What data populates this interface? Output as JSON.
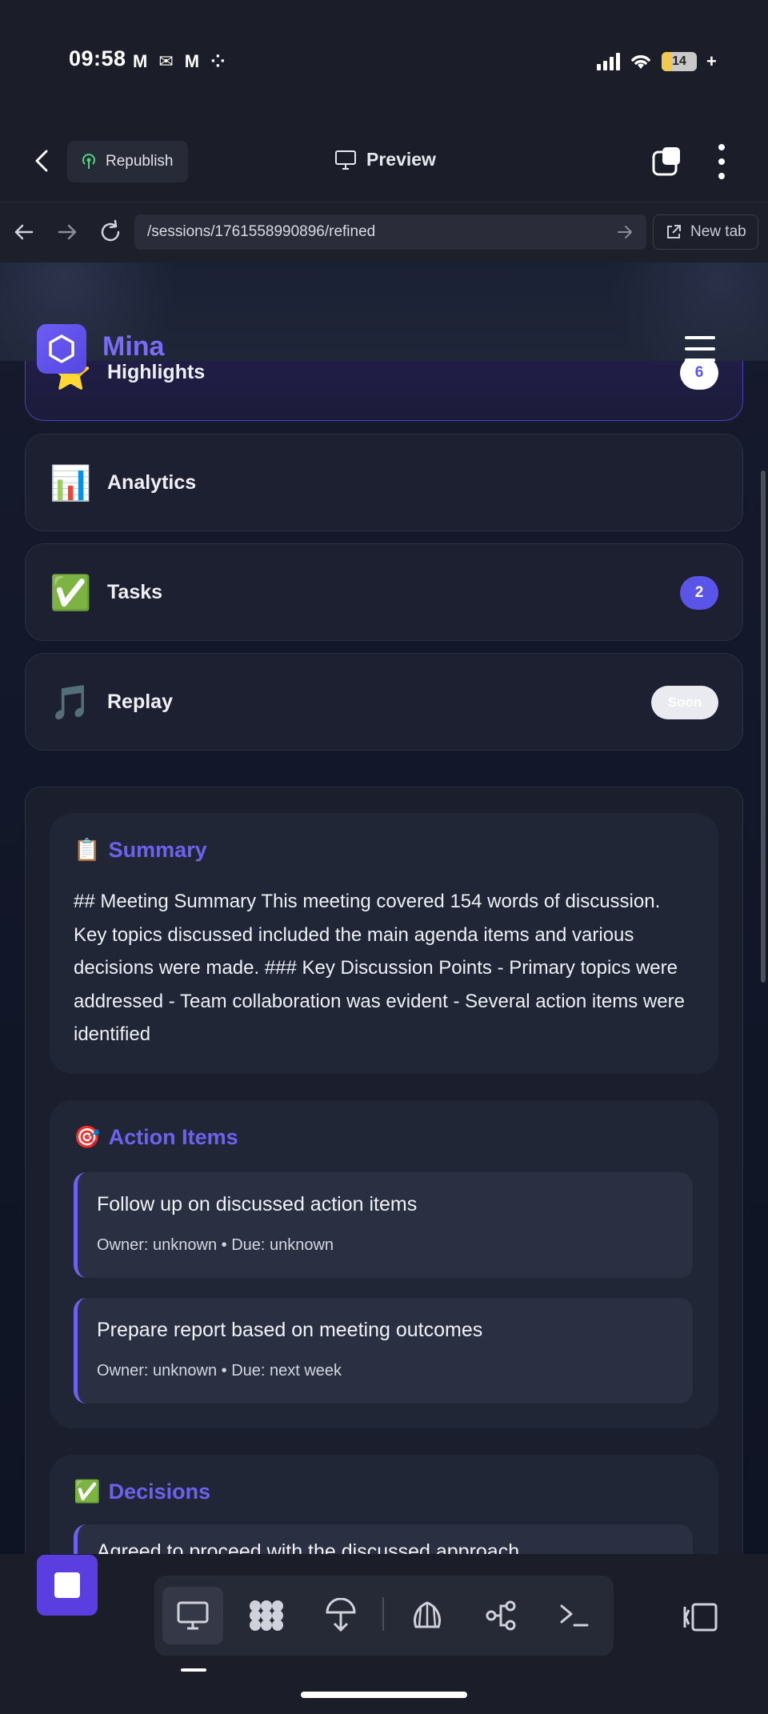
{
  "status_bar": {
    "time": "09:58",
    "battery": "14"
  },
  "topbar": {
    "republish_label": "Republish",
    "preview_label": "Preview"
  },
  "url_bar": {
    "url": "/sessions/1761558990896/refined",
    "new_tab_label": "New tab"
  },
  "site": {
    "brand": "Mina"
  },
  "nav": {
    "items": [
      {
        "icon": "⭐",
        "label": "Highlights",
        "badge": "6",
        "active": true
      },
      {
        "icon": "📊",
        "label": "Analytics",
        "badge": ""
      },
      {
        "icon": "✅",
        "label": "Tasks",
        "badge": "2"
      },
      {
        "icon": "🎵",
        "label": "Replay",
        "badge": "Soon"
      }
    ]
  },
  "summary": {
    "icon": "📋",
    "title": "Summary",
    "text": "## Meeting Summary This meeting covered 154 words of discussion. Key topics discussed included the main agenda items and various decisions were made. ### Key Discussion Points - Primary topics were addressed - Team collaboration was evident - Several action items were identified"
  },
  "action_items": {
    "icon": "🎯",
    "title": "Action Items",
    "items": [
      {
        "title": "Follow up on discussed action items",
        "meta": "Owner: unknown • Due: unknown"
      },
      {
        "title": "Prepare report based on meeting outcomes",
        "meta": "Owner: unknown • Due: next week"
      }
    ]
  },
  "decisions": {
    "icon": "✅",
    "title": "Decisions",
    "first_item": "Agreed to proceed with the discussed approach"
  },
  "colors": {
    "accent": "#6d62ee",
    "background": "#1b1d28",
    "brand": "#7b6cf6"
  }
}
